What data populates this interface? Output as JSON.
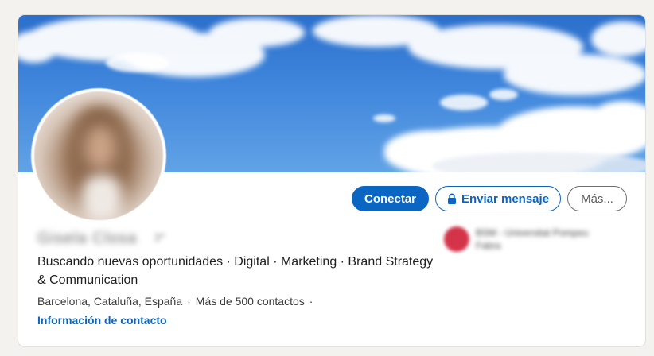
{
  "profile": {
    "name": "Gisela Closa",
    "pronoun_badge": "3º",
    "headline": "Buscando nuevas oportunidades · Digital · Marketing · Brand Strategy & Communication",
    "location": "Barcelona, Cataluña, España",
    "separator": "·",
    "connections": "Más de 500 contactos",
    "trailing_separator": "·",
    "contact_info_link": "Información de contacto"
  },
  "education": {
    "name": "BSM - Universitat Pompeu Fabra"
  },
  "actions": {
    "connect_label": "Conectar",
    "message_label": "Enviar mensaje",
    "more_label": "Más..."
  },
  "colors": {
    "accent": "#0a66c2",
    "page_background": "#f4f2ee",
    "card_background": "#ffffff"
  },
  "icons": {
    "message_button_icon": "lock-icon"
  }
}
